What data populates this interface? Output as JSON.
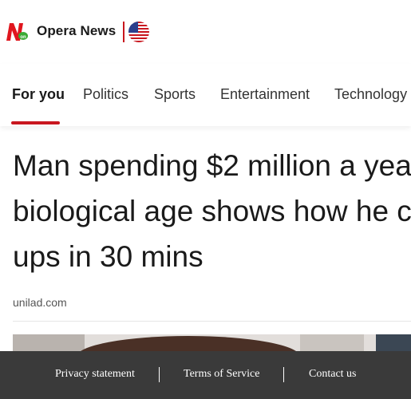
{
  "header": {
    "brand": "Opera News",
    "logo_icon": "opera-news-logo-icon",
    "region_icon": "us-flag-icon",
    "accent": "#c8161e"
  },
  "tabs": [
    {
      "label": "For you",
      "active": true
    },
    {
      "label": "Politics",
      "active": false
    },
    {
      "label": "Sports",
      "active": false
    },
    {
      "label": "Entertainment",
      "active": false
    },
    {
      "label": "Technology",
      "active": false
    }
  ],
  "article": {
    "title_lines": [
      "Man spending $2 million a yea",
      "biological age shows how he c",
      "ups in 30 mins"
    ],
    "source": "unilad.com"
  },
  "footer": {
    "privacy": "Privacy statement",
    "terms": "Terms of Service",
    "contact": "Contact us",
    "background": "#3a3a3a"
  }
}
